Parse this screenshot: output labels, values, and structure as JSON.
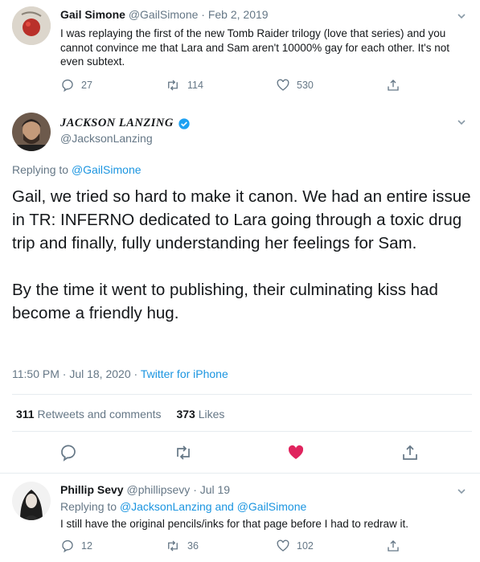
{
  "tweet1": {
    "name": "Gail Simone",
    "handle": "@GailSimone",
    "date": "· Feb 2, 2019",
    "text": "I was replaying the first of the new Tomb Raider trilogy (love that series) and you cannot convince me that Lara and Sam aren't 10000% gay for each other.  It's not even subtext.",
    "replies": "27",
    "retweets": "114",
    "likes": "530"
  },
  "tweet2": {
    "name": "JACKSON LANZING",
    "handle": "@JacksonLanzing",
    "replying_prefix": "Replying to ",
    "replying_to": "@GailSimone",
    "text_p1": "Gail, we tried so hard to make it canon. We had an entire issue in TR: INFERNO dedicated to Lara going through a toxic drug trip and finally, fully understanding her feelings for Sam.",
    "text_p2": "By the time it went to publishing, their culminating kiss had become a friendly hug.",
    "time": "11:50 PM · Jul 18, 2020",
    "dot": " · ",
    "source": "Twitter for iPhone",
    "retweets_count": "311",
    "retweets_label": "Retweets and comments",
    "likes_count": "373",
    "likes_label": "Likes"
  },
  "tweet3": {
    "name": "Phillip Sevy",
    "handle": "@phillipsevy",
    "date": "· Jul 19",
    "replying_prefix": "Replying to ",
    "replying_to_1": "@JacksonLanzing",
    "replying_and": "and",
    "replying_to_2": "@GailSimone",
    "text": "I still have the original pencils/inks for that page before I had to redraw it.",
    "replies": "12",
    "retweets": "36",
    "likes": "102"
  },
  "colors": {
    "link": "#1b95e0",
    "like_active": "#e0245e",
    "muted": "#657786",
    "verified": "#1da1f2"
  }
}
